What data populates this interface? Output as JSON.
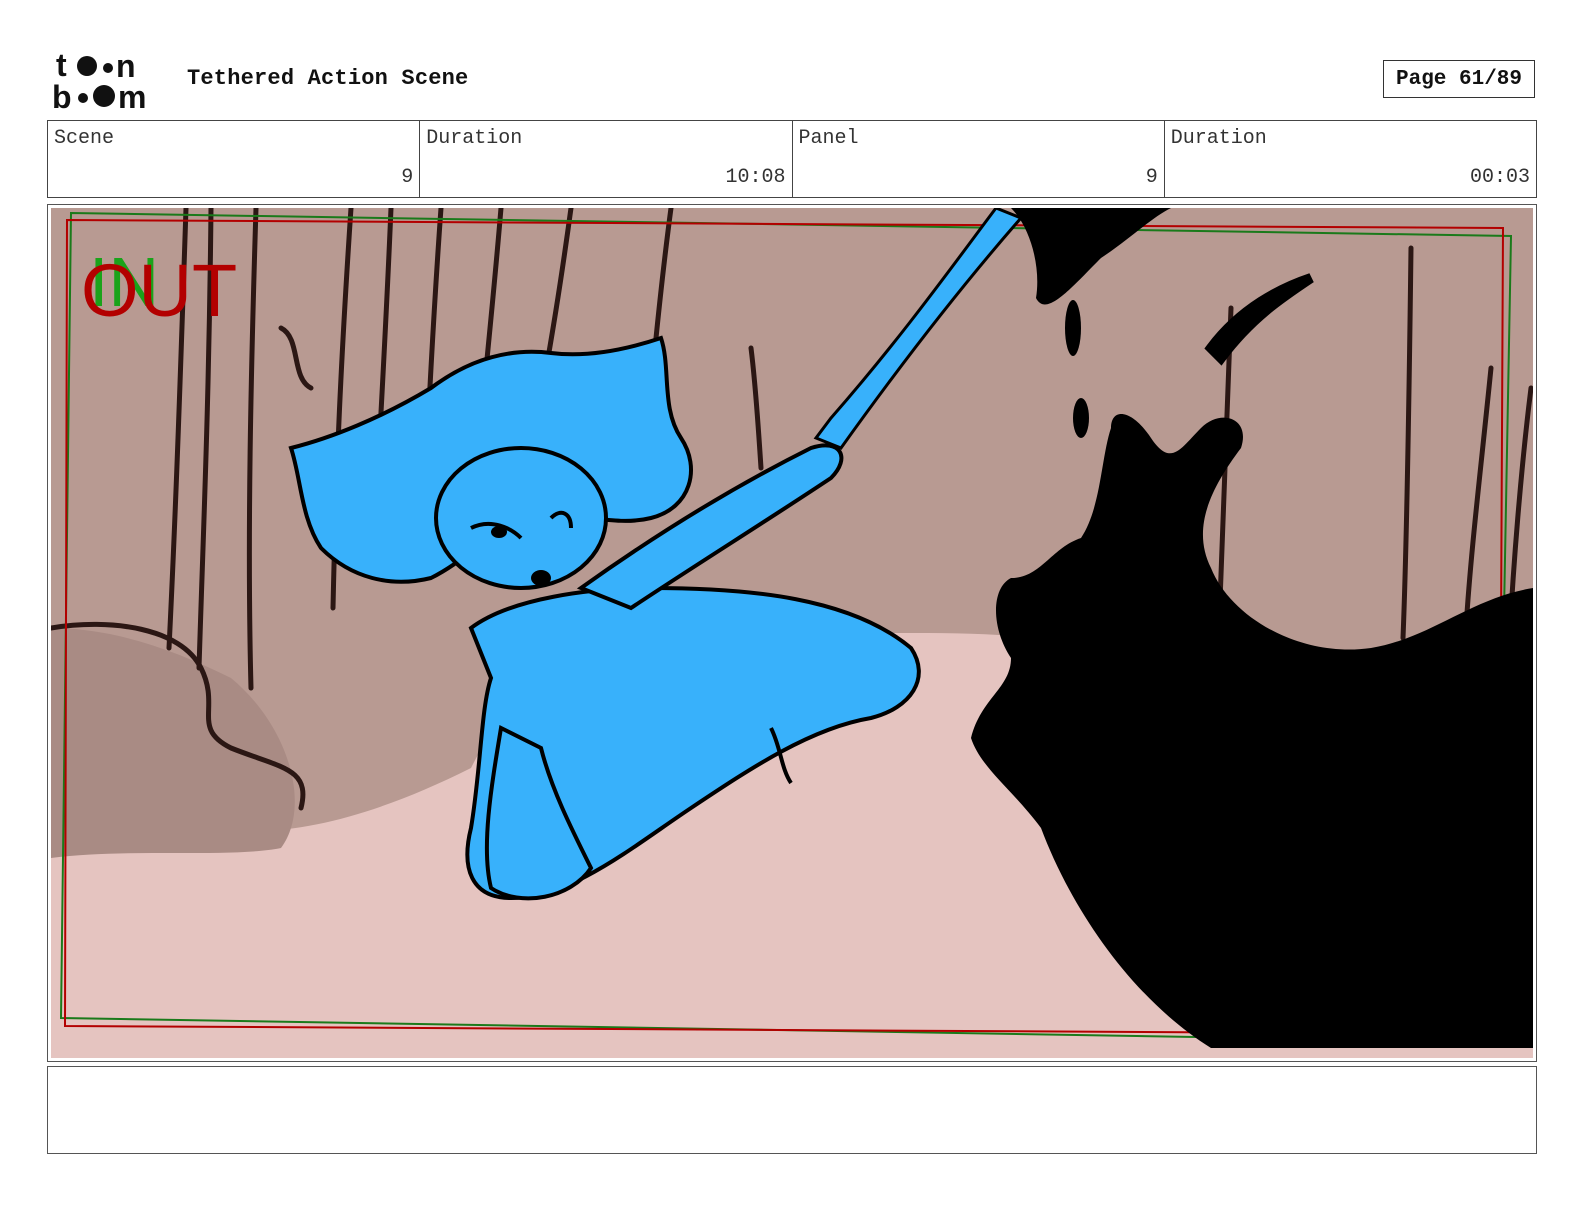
{
  "header": {
    "logo_text": "toonboom",
    "title": "Tethered Action Scene",
    "page_label": "Page 61/89"
  },
  "info": {
    "scene_label": "Scene",
    "scene_value": "9",
    "scene_duration_label": "Duration",
    "scene_duration_value": "10:08",
    "panel_label": "Panel",
    "panel_value": "9",
    "panel_duration_label": "Duration",
    "panel_duration_value": "00:03"
  },
  "panel": {
    "in_marker": "IN",
    "out_marker": "OUT",
    "colors": {
      "background": "#e5c4c0",
      "trees": "#b89a92",
      "character": "#38b1fb",
      "creature": "#000000",
      "in_frame": "#1a7a1a",
      "out_frame": "#b30000"
    }
  },
  "notes": {
    "text": ""
  }
}
